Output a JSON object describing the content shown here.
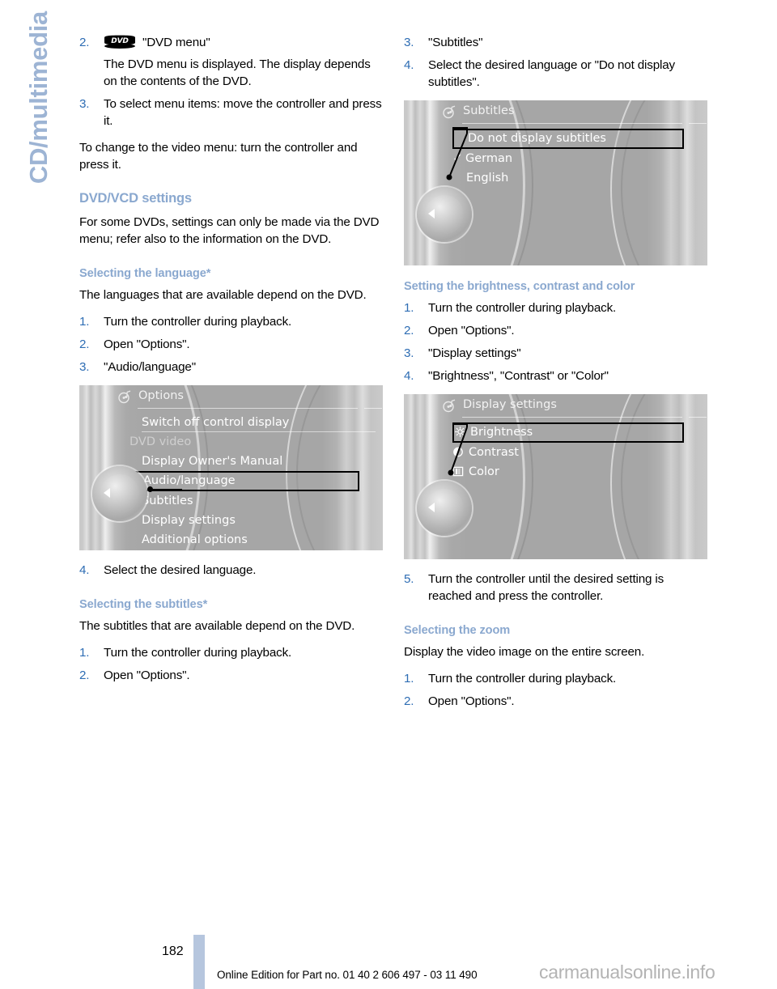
{
  "chapter": {
    "label": "CD/multimedia"
  },
  "left_column": {
    "step2": {
      "num": "2.",
      "icon": "dvd-logo-icon",
      "text": "\"DVD menu\"",
      "detail": "The DVD menu is displayed. The display depends on the contents of the DVD."
    },
    "step3": {
      "num": "3.",
      "text": "To select menu items: move the controller and press it."
    },
    "para_video_menu": "To change to the video menu: turn the controller and press it.",
    "section_title": "DVD/VCD settings",
    "section_body": "For some DVDs, settings can only be made via the DVD menu; refer also to the information on the DVD.",
    "sub_language": {
      "title": "Selecting the language*",
      "body": "The languages that are available depend on the DVD.",
      "steps": [
        {
          "num": "1.",
          "text": "Turn the controller during playback."
        },
        {
          "num": "2.",
          "text": "Open \"Options\"."
        },
        {
          "num": "3.",
          "text": "\"Audio/language\""
        }
      ],
      "step4": {
        "num": "4.",
        "text": "Select the desired language."
      }
    },
    "sub_subtitles": {
      "title": "Selecting the subtitles*",
      "body": "The subtitles that are available depend on the DVD.",
      "steps": [
        {
          "num": "1.",
          "text": "Turn the controller during playback."
        },
        {
          "num": "2.",
          "text": "Open \"Options\"."
        }
      ]
    },
    "screen_options": {
      "title": "Options",
      "title_icon": "cd-multimedia-icon",
      "items": [
        {
          "label": "Switch off control display",
          "style": "rule-under"
        },
        {
          "label": "DVD video",
          "style": "dim"
        },
        {
          "label": "Display Owner's Manual",
          "style": "plain"
        },
        {
          "label": "Audio/language",
          "style": "selected"
        },
        {
          "label": "Subtitles",
          "style": "plain"
        },
        {
          "label": "Display settings",
          "style": "plain"
        },
        {
          "label": "Additional options",
          "style": "plain"
        }
      ]
    }
  },
  "right_column": {
    "step3": {
      "num": "3.",
      "text": "\"Subtitles\""
    },
    "step4": {
      "num": "4.",
      "text": "Select the desired language or \"Do not display subtitles\"."
    },
    "screen_subtitles": {
      "title": "Subtitles",
      "title_icon": "cd-multimedia-icon",
      "items": [
        {
          "label": "Do not display subtitles",
          "style": "selected"
        },
        {
          "label": "German",
          "style": "checked",
          "check": "✓"
        },
        {
          "label": "English",
          "style": "plain"
        }
      ]
    },
    "sub_brightness": {
      "title": "Setting the brightness, contrast and color",
      "steps": [
        {
          "num": "1.",
          "text": "Turn the controller during playback."
        },
        {
          "num": "2.",
          "text": "Open \"Options\"."
        },
        {
          "num": "3.",
          "text": "\"Display settings\""
        },
        {
          "num": "4.",
          "text": "\"Brightness\", \"Contrast\" or \"Color\""
        }
      ],
      "step5": {
        "num": "5.",
        "text": "Turn the controller until the desired setting is reached and press the controller."
      }
    },
    "screen_display_settings": {
      "title": "Display settings",
      "title_icon": "cd-multimedia-icon",
      "items": [
        {
          "label": "Brightness",
          "style": "selected",
          "icon": "sun-icon"
        },
        {
          "label": "Contrast",
          "style": "plain",
          "icon": "contrast-icon"
        },
        {
          "label": "Color",
          "style": "plain",
          "icon": "color-icon"
        }
      ]
    },
    "sub_zoom": {
      "title": "Selecting the zoom",
      "body": "Display the video image on the entire screen.",
      "steps": [
        {
          "num": "1.",
          "text": "Turn the controller during playback."
        },
        {
          "num": "2.",
          "text": "Open \"Options\"."
        }
      ]
    }
  },
  "footer": {
    "page_number": "182",
    "edition_text": "Online Edition for Part no. 01 40 2 606 497 - 03 11 490",
    "watermark": "carmanualsonline.info"
  },
  "colors": {
    "heading_blue": "#8aa8cf",
    "number_blue": "#2e6db4",
    "tab_blue": "#9db4d4",
    "footer_bar": "#b6c6de"
  }
}
